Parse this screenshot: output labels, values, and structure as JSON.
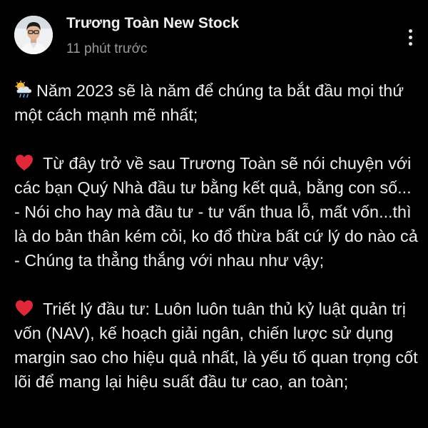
{
  "post": {
    "author": "Trương Toàn New Stock",
    "time": "11 phút trước",
    "more_icon": "more-vertical-icon",
    "paragraphs": [
      {
        "icon": "cloud-sun-rain-icon",
        "text": "Năm 2023 sẽ là năm để chúng ta bắt đầu mọi thứ một cách mạnh mẽ nhất;"
      },
      {
        "icon": "red-heart-icon",
        "text": "Từ đây trở về sau Trương Toàn sẽ nói chuyện với các bạn Quý Nhà đầu tư bằng kết quả, bằng con số... - Nói cho hay mà đầu tư - tư vấn thua lỗ, mất vốn...thì là do bản thân kém cỏi, ko đổ thừa bất cứ lý do nào cả - Chúng ta thẳng thắng với nhau như vậy;"
      },
      {
        "icon": "red-heart-icon",
        "text": "Triết lý đầu tư: Luôn luôn tuân thủ kỷ luật quản trị vốn (NAV), kế hoạch giải ngân, chiến lược sử dụng margin sao cho hiệu quả nhất, là yếu tố quan trọng cốt lõi để mang lại hiệu suất đầu tư cao, an toàn;"
      }
    ]
  },
  "colors": {
    "background": "#000000",
    "text": "#ececec",
    "meta": "#9a9a9a",
    "heart": "#e0283a"
  }
}
